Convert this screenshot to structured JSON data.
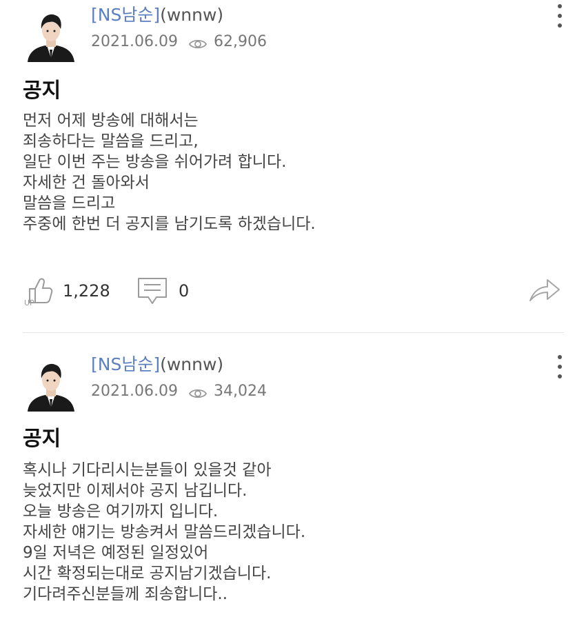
{
  "posts": [
    {
      "author_nick": "[NS남순]",
      "author_id": "(wnnw)",
      "date": "2021.06.09",
      "views": "62,906",
      "title": "공지",
      "body": [
        "먼저 어제 방송에 대해서는",
        "죄송하다는 말씀을 드리고,",
        "일단 이번 주는 방송을 쉬어가려 합니다.",
        "자세한 건 돌아와서",
        "말씀을 드리고",
        "주중에 한번 더 공지를 남기도록 하겠습니다."
      ],
      "likes": "1,228",
      "comments": "0"
    },
    {
      "author_nick": "[NS남순]",
      "author_id": "(wnnw)",
      "date": "2021.06.09",
      "views": "34,024",
      "title": "공지",
      "body": [
        "혹시나 기다리시는분들이 있을것 같아",
        "늦었지만 이제서야 공지 남깁니다.",
        "오늘 방송은 여기까지 입니다.",
        "자세한 얘기는 방송켜서 말씀드리겠습니다.",
        "9일 저녁은 예정된 일정있어",
        "시간 확정되는대로 공지남기겠습니다.",
        "기다려주신분들께 죄송합니다.."
      ]
    }
  ],
  "icons": {
    "views": "eye-icon",
    "like": "thumbs-up-icon",
    "comment": "comment-icon",
    "share": "share-arrow-icon",
    "menu": "more-vertical-icon"
  },
  "colors": {
    "nickname": "#5a7fbf",
    "meta": "#777777",
    "body": "#444444",
    "divider": "#e2e2e2"
  }
}
